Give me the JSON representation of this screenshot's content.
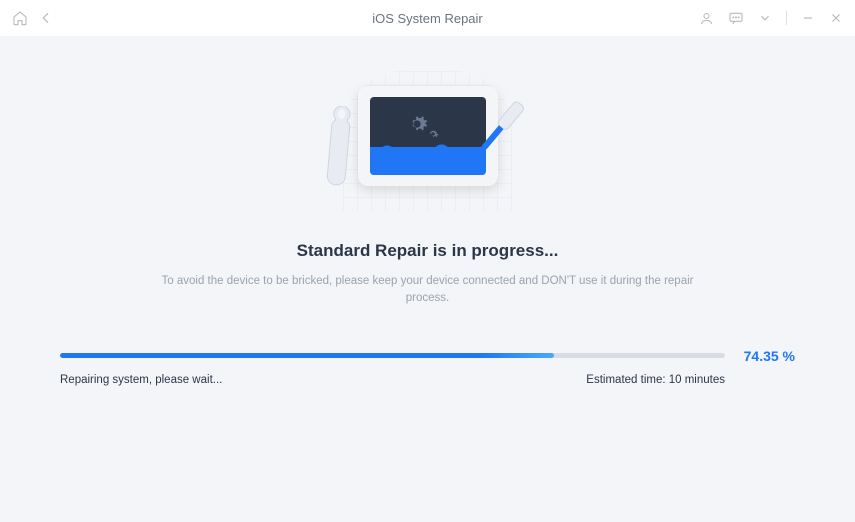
{
  "titlebar": {
    "title": "iOS System Repair"
  },
  "main": {
    "title": "Standard Repair is in progress...",
    "subtitle": "To avoid the device to be bricked, please keep your device connected and DON'T use it during the repair process."
  },
  "progress": {
    "percent": 74.35,
    "percent_label": "74.35 %",
    "status_text": "Repairing system, please wait...",
    "estimated_time": "Estimated time: 10 minutes"
  }
}
